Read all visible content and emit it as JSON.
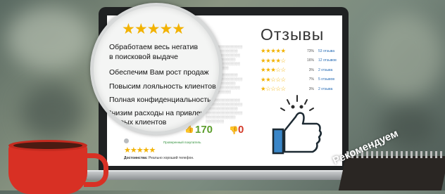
{
  "magnifier": {
    "lines": [
      "Обработаем весь негатив",
      "в поисковой выдаче",
      "Обеспечим Вам рост продаж",
      "Повысим лояльность клиентов",
      "Полная конфиденциальность",
      "Снизим расходы на привлечение",
      "новых клиентов"
    ]
  },
  "reviews_panel": {
    "title": "Отзывы",
    "rows": [
      {
        "stars": "★★★★★",
        "percent": "73%",
        "count": "53 отзыва"
      },
      {
        "stars": "★★★★☆",
        "percent": "16%",
        "count": "12 отзывов"
      },
      {
        "stars": "★★★☆☆",
        "percent": "3%",
        "count": "2 отзыва"
      },
      {
        "stars": "★★☆☆☆",
        "percent": "7%",
        "count": "5 отзывов"
      },
      {
        "stars": "★☆☆☆☆",
        "percent": "3%",
        "count": "2 отзыва"
      }
    ]
  },
  "votes": {
    "up": "170",
    "down": "0"
  },
  "review": {
    "stars": "★★★★★",
    "badge": "Проверенный покупатель",
    "text_label": "Достоинства:",
    "text": "Реально хороший телефон."
  },
  "stamp": {
    "text": "Рекомендуем"
  },
  "colors": {
    "star": "#f2b200",
    "up": "#5c9e2c",
    "down": "#d33a2a",
    "thumb": "#3a86c8",
    "mug": "#d83024"
  }
}
